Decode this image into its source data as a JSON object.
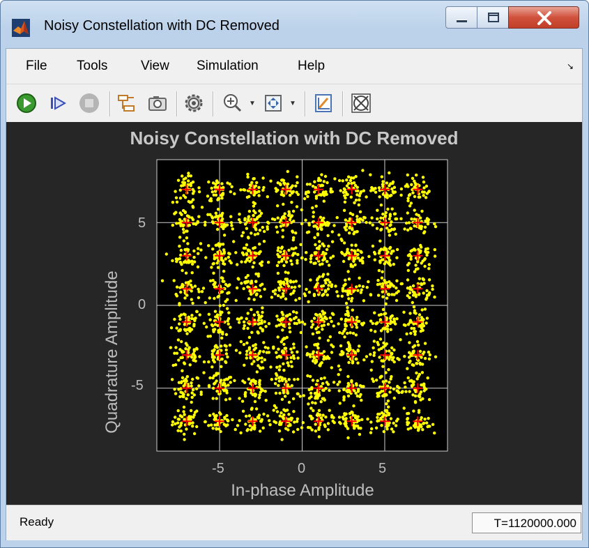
{
  "window": {
    "title": "Noisy Constellation with DC Removed",
    "icon": "matlab-logo-icon",
    "controls": [
      "minimize-icon",
      "maximize-icon",
      "close-icon"
    ]
  },
  "menu": {
    "items": [
      "File",
      "Tools",
      "View",
      "Simulation",
      "Help"
    ],
    "overflow_icon": "menu-collapse-arrow-icon"
  },
  "toolbar": {
    "buttons": [
      {
        "icon": "run-icon"
      },
      {
        "icon": "step-forward-icon"
      },
      {
        "icon": "stop-icon"
      },
      {
        "icon": "highlight-block-icon"
      },
      {
        "icon": "snapshot-camera-icon"
      },
      {
        "icon": "settings-gear-icon"
      },
      {
        "icon": "zoom-in-icon"
      },
      {
        "icon": "autoscale-icon"
      },
      {
        "icon": "style-icon"
      },
      {
        "icon": "reference-constellation-icon"
      }
    ]
  },
  "colors": {
    "plot_background": "#262626",
    "axes_background": "#000000",
    "points": "#ffff00",
    "reference_markers": "#ff0000",
    "grid": "#d0d0d0",
    "text": "#bdbdbd"
  },
  "chart_data": {
    "type": "scatter",
    "title": "Noisy Constellation with DC Removed",
    "xlabel": "In-phase Amplitude",
    "ylabel": "Quadrature Amplitude",
    "xlim": [
      -8.8,
      8.8
    ],
    "ylim": [
      -8.8,
      8.8
    ],
    "xticks": [
      -5,
      0,
      5
    ],
    "yticks": [
      5,
      0,
      -5
    ],
    "grid": true,
    "series": [
      {
        "name": "",
        "marker": "dot",
        "color": "#ffff00",
        "description_type": "noisy-received-samples",
        "cluster_centers": [
          -7,
          -5,
          -3,
          -1,
          1,
          3,
          5,
          7
        ],
        "cluster_spread_sd": 0.42,
        "points_per_cluster": 42
      },
      {
        "name": "",
        "marker": "plus",
        "color": "#ff0000",
        "i_values": [
          -7,
          -5,
          -3,
          -1,
          1,
          3,
          5,
          7
        ],
        "q_values": [
          -7,
          -5,
          -3,
          -1,
          1,
          3,
          5,
          7
        ]
      }
    ]
  },
  "status": {
    "text": "Ready",
    "time": "T=1120000.000"
  }
}
